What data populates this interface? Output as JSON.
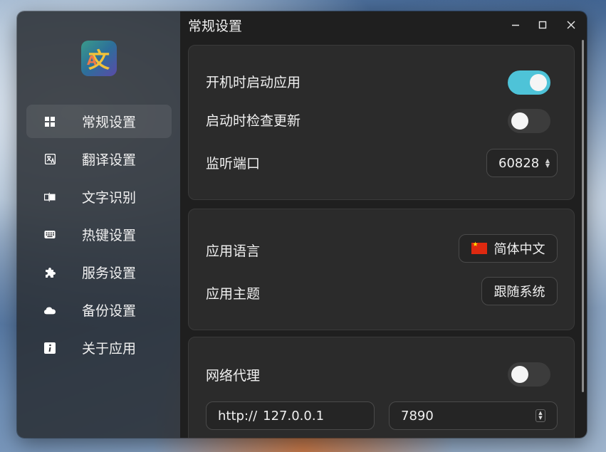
{
  "window": {
    "title": "常规设置"
  },
  "sidebar": {
    "logo_glyph": "文",
    "logo_sub": "A",
    "items": [
      {
        "label": "常规设置",
        "icon": "grid-icon",
        "active": true
      },
      {
        "label": "翻译设置",
        "icon": "translate-icon"
      },
      {
        "label": "文字识别",
        "icon": "ocr-icon"
      },
      {
        "label": "热键设置",
        "icon": "keyboard-icon"
      },
      {
        "label": "服务设置",
        "icon": "puzzle-icon"
      },
      {
        "label": "备份设置",
        "icon": "cloud-icon"
      },
      {
        "label": "关于应用",
        "icon": "info-icon"
      }
    ]
  },
  "general": {
    "autostart_label": "开机时启动应用",
    "autostart_on": true,
    "check_update_label": "启动时检查更新",
    "check_update_on": false,
    "port_label": "监听端口",
    "port_value": "60828"
  },
  "appearance": {
    "language_label": "应用语言",
    "language_value": "简体中文",
    "theme_label": "应用主题",
    "theme_value": "跟随系统"
  },
  "proxy": {
    "label": "网络代理",
    "enabled": false,
    "scheme": "http://",
    "host": "127.0.0.1",
    "port": "7890"
  },
  "colors": {
    "accent": "#4ec3d8"
  }
}
